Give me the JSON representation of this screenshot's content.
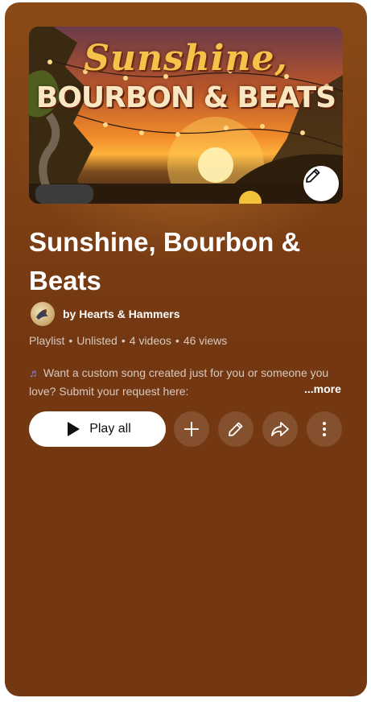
{
  "thumbnail": {
    "title_line1": "Sunshine,",
    "title_line2": "BOURBON & BEATS"
  },
  "playlist": {
    "title": "Sunshine, Bourbon & Beats",
    "author": "by Hearts & Hammers",
    "type": "Playlist",
    "visibility": "Unlisted",
    "videos": "4 videos",
    "views": "46 views",
    "description": "Want a custom song created just for you or someone you love? Submit your request here:",
    "more_label": "...more"
  },
  "actions": {
    "play_all_label": "Play all"
  },
  "icons": {
    "edit_thumbnail": "pencil-icon",
    "play": "play-icon",
    "add": "plus-icon",
    "edit": "pencil-icon",
    "share": "share-arrow-icon",
    "more": "vertical-dots-icon",
    "description_note": "music-note-icon"
  },
  "colors": {
    "panel_background": "#733812",
    "primary_text": "#ffffff",
    "secondary_text": "#d8c2b2",
    "play_button_bg": "#ffffff"
  }
}
